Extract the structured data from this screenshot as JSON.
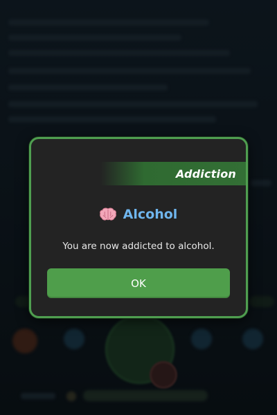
{
  "dialog": {
    "ribbon_label": "Addiction",
    "title": "Alcohol",
    "icon": "brain-icon",
    "message": "You are now addicted to alcohol.",
    "ok_label": "OK"
  },
  "colors": {
    "border": "#4f9e50",
    "ribbon": "#336f35",
    "title": "#6fb6ee",
    "button": "#4f9e4b",
    "dialog_bg": "#232323"
  }
}
